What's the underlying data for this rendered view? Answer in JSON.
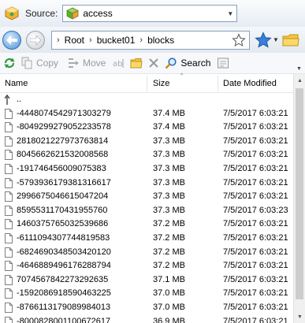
{
  "source": {
    "label": "Source:",
    "value": "access"
  },
  "breadcrumb": [
    "Root",
    "bucket01",
    "blocks"
  ],
  "toolbar": {
    "copy": "Copy",
    "move": "Move",
    "search": "Search"
  },
  "columns": {
    "name": "Name",
    "size": "Size",
    "modified": "Date Modified"
  },
  "parent_row": "..",
  "files": [
    {
      "name": "-4448074542971303279",
      "size": "37.4 MB",
      "date": "7/5/2017 6:03:21"
    },
    {
      "name": "-8049299279052233578",
      "size": "37.4 MB",
      "date": "7/5/2017 6:03:21"
    },
    {
      "name": "2818021227973763814",
      "size": "37.3 MB",
      "date": "7/5/2017 6:03:21"
    },
    {
      "name": "8045662621532008568",
      "size": "37.3 MB",
      "date": "7/5/2017 6:03:21"
    },
    {
      "name": "-191746456009075383",
      "size": "37.3 MB",
      "date": "7/5/2017 6:03:21"
    },
    {
      "name": "-5793936179381316617",
      "size": "37.3 MB",
      "date": "7/5/2017 6:03:21"
    },
    {
      "name": "2996675046615047204",
      "size": "37.3 MB",
      "date": "7/5/2017 6:03:21"
    },
    {
      "name": "859553117043195576​0",
      "size": "37.3 MB",
      "date": "7/5/2017 6:03:23"
    },
    {
      "name": "1460375765032539686",
      "size": "37.2 MB",
      "date": "7/5/2017 6:03:21"
    },
    {
      "name": "-611109430774481958​3",
      "size": "37.2 MB",
      "date": "7/5/2017 6:03:21"
    },
    {
      "name": "-6824690348503420120",
      "size": "37.2 MB",
      "date": "7/5/2017 6:03:21"
    },
    {
      "name": "-4646889496176288794",
      "size": "37.2 MB",
      "date": "7/5/2017 6:03:21"
    },
    {
      "name": "7074567842273292635",
      "size": "37.1 MB",
      "date": "7/5/2017 6:03:21"
    },
    {
      "name": "-1592086918590463225",
      "size": "37.0 MB",
      "date": "7/5/2017 6:03:21"
    },
    {
      "name": "-8766113179089984013",
      "size": "37.0 MB",
      "date": "7/5/2017 6:03:21"
    },
    {
      "name": "-8000828001100672617",
      "size": "36.9 MB",
      "date": "7/5/2017 6:03:21"
    }
  ]
}
